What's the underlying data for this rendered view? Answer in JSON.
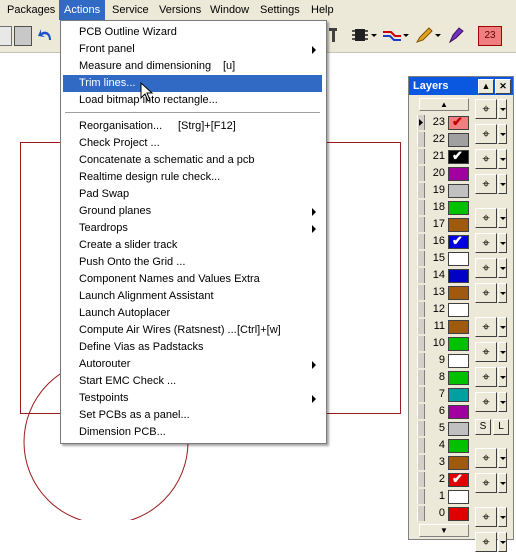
{
  "menubar": {
    "items": [
      "Packages",
      "Actions",
      "Service",
      "Versions",
      "Window",
      "Settings",
      "Help"
    ],
    "active": "Actions"
  },
  "toolbar": {
    "layer_badge": "23"
  },
  "actions_menu": {
    "items": [
      {
        "label": "PCB Outline Wizard"
      },
      {
        "label": "Front panel",
        "submenu": true
      },
      {
        "label": "Measure and dimensioning",
        "shortcut": "[u]"
      },
      {
        "label": "Trim lines...",
        "highlighted": true
      },
      {
        "label": "Load bitmap into rectangle..."
      },
      {
        "label": "Reorganisation...",
        "shortcut": "[Strg]+[F12]"
      },
      {
        "label": "Check Project ..."
      },
      {
        "label": "Concatenate a schematic and a pcb"
      },
      {
        "label": "Realtime design rule check..."
      },
      {
        "label": "Pad Swap"
      },
      {
        "label": "Ground planes",
        "submenu": true
      },
      {
        "label": "Teardrops",
        "submenu": true
      },
      {
        "label": "Create a slider track"
      },
      {
        "label": "Push Onto the Grid ..."
      },
      {
        "label": "Component Names and Values Extra"
      },
      {
        "label": "Launch Alignment Assistant"
      },
      {
        "label": "Launch Autoplacer"
      },
      {
        "label": "Compute Air Wires (Ratsnest) ...",
        "shortcut": "[Ctrl]+[w]"
      },
      {
        "label": "Define Vias as Padstacks"
      },
      {
        "label": "Autorouter",
        "submenu": true
      },
      {
        "label": "Start EMC Check ..."
      },
      {
        "label": "Testpoints",
        "submenu": true
      },
      {
        "label": "Set PCBs as a panel..."
      },
      {
        "label": "Dimension PCB..."
      }
    ]
  },
  "layers_panel": {
    "title": "Layers",
    "s_label": "S",
    "l_label": "L",
    "active_layer": "23",
    "layers": [
      {
        "num": "23",
        "color": "#f08080",
        "checked": true
      },
      {
        "num": "22",
        "color": "#a0a0a0",
        "checked": false
      },
      {
        "num": "21",
        "color": "#000000",
        "checked": true
      },
      {
        "num": "20",
        "color": "#a000a0",
        "checked": false
      },
      {
        "num": "19",
        "color": "#c0c0c0",
        "checked": false
      },
      {
        "num": "18",
        "color": "#00c000",
        "checked": false
      },
      {
        "num": "17",
        "color": "#a05a10",
        "checked": false
      },
      {
        "num": "16",
        "color": "#0000e0",
        "checked": true
      },
      {
        "num": "15",
        "color": "#ffffff",
        "checked": false
      },
      {
        "num": "14",
        "color": "#0000c8",
        "checked": false
      },
      {
        "num": "13",
        "color": "#a05a10",
        "checked": false
      },
      {
        "num": "12",
        "color": "#ffffff",
        "checked": false
      },
      {
        "num": "11",
        "color": "#a05a10",
        "checked": false
      },
      {
        "num": "10",
        "color": "#00c000",
        "checked": false
      },
      {
        "num": "9",
        "color": "#ffffff",
        "checked": false
      },
      {
        "num": "8",
        "color": "#00c000",
        "checked": false
      },
      {
        "num": "7",
        "color": "#00a0a0",
        "checked": false
      },
      {
        "num": "6",
        "color": "#a000a0",
        "checked": false
      },
      {
        "num": "5",
        "color": "#c0c0c0",
        "checked": false
      },
      {
        "num": "4",
        "color": "#00c000",
        "checked": false
      },
      {
        "num": "3",
        "color": "#a05a10",
        "checked": false
      },
      {
        "num": "2",
        "color": "#e00000",
        "checked": true
      },
      {
        "num": "1",
        "color": "#ffffff",
        "checked": false
      },
      {
        "num": "0",
        "color": "#e00000",
        "checked": false
      }
    ]
  }
}
